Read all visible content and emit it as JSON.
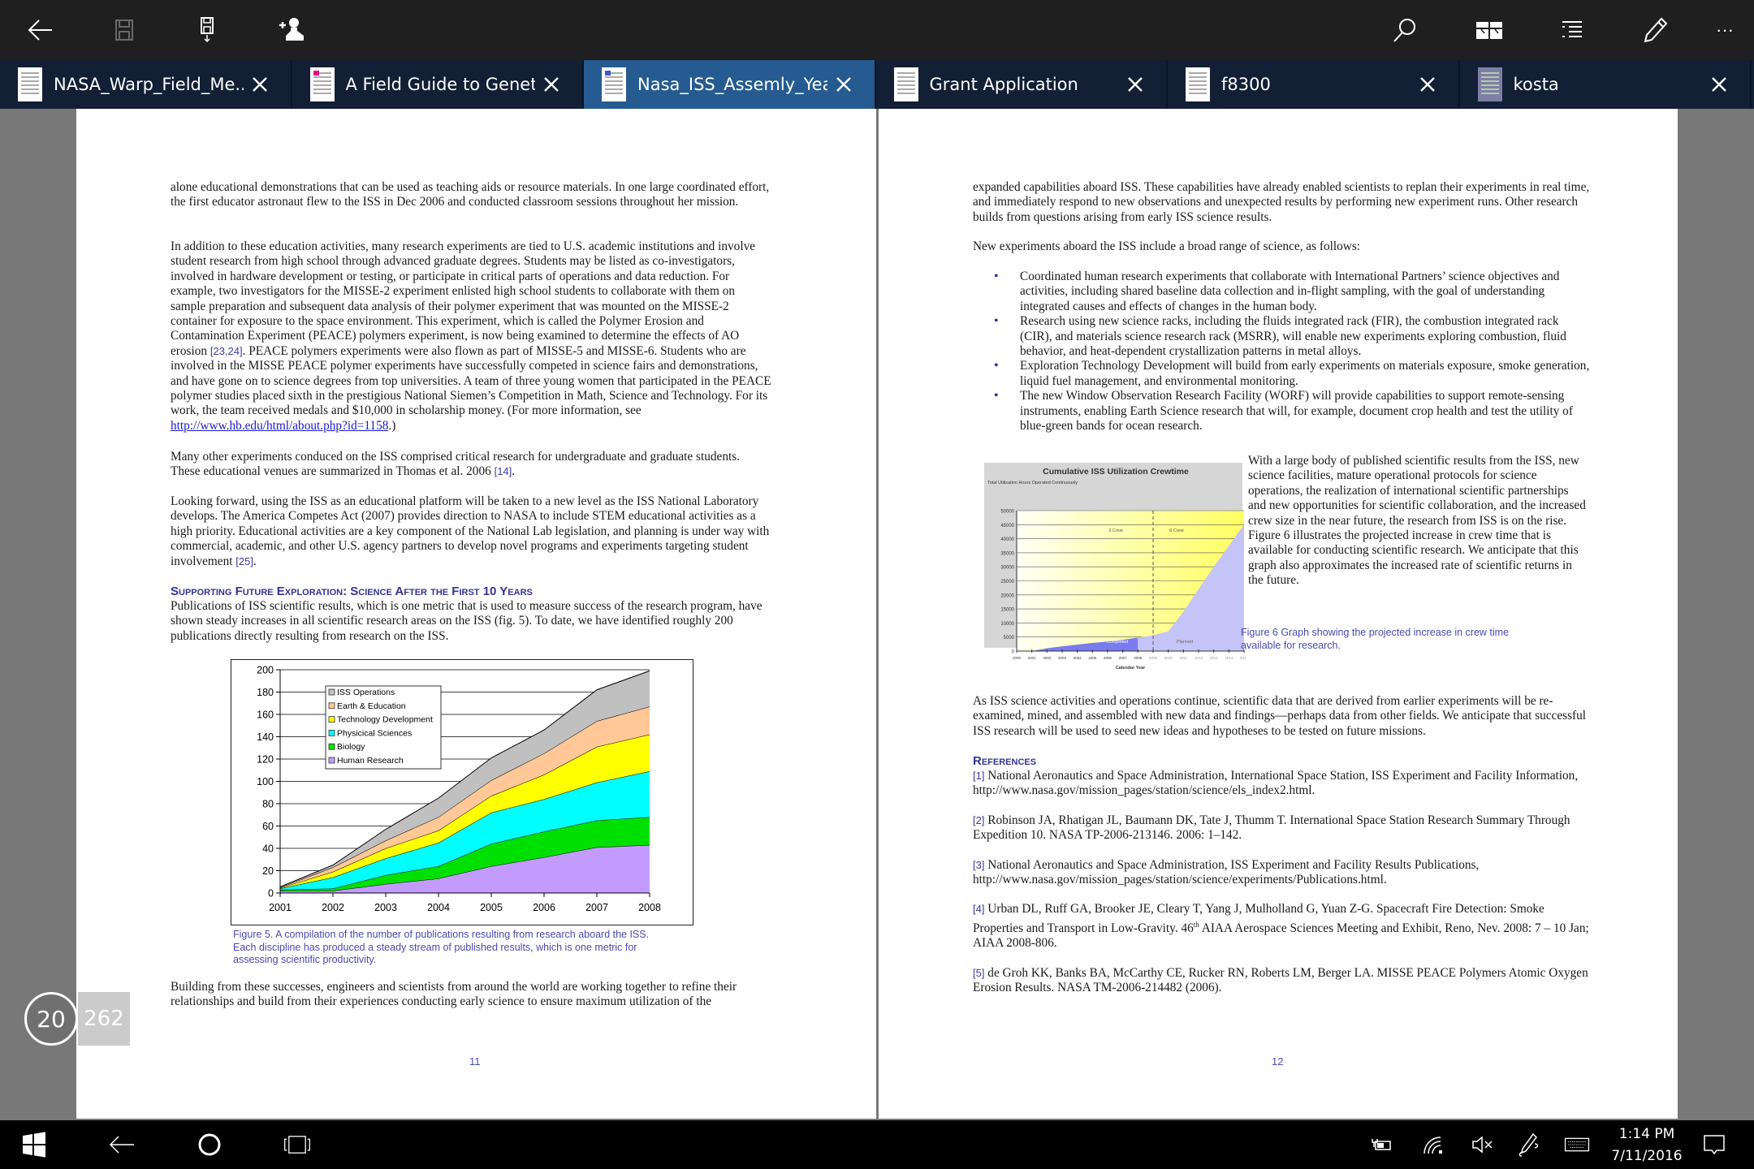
{
  "toolbar": {
    "left": [
      "back-icon",
      "save-icon",
      "save-as-icon",
      "share-user-icon"
    ],
    "right": [
      "search-icon",
      "two-page-view-icon",
      "outline-icon",
      "pen-icon",
      "more-icon"
    ],
    "more_label": "···"
  },
  "tabs": [
    {
      "label": "NASA_Warp_Field_Me...",
      "active": false
    },
    {
      "label": "A Field Guide to Genet...",
      "active": false
    },
    {
      "label": "Nasa_ISS_Assemly_Years",
      "active": true
    },
    {
      "label": "Grant Application",
      "active": false
    },
    {
      "label": "f8300",
      "active": false
    },
    {
      "label": "kosta",
      "active": false
    }
  ],
  "tab_close_label": "X",
  "left_page": {
    "p1": "alone educational demonstrations that can be used as teaching aids or resource materials. In one large coordinated effort, the first educator astronaut flew to the ISS in Dec 2006 and conducted classroom sessions throughout her mission.",
    "p2_a": "In addition to these education activities, many research experiments are tied to U.S. academic institutions and involve student research from high school through advanced graduate degrees. Students may be listed as co-investigators, involved in hardware development or testing, or participate in critical parts of operations and data reduction. For example, two investigators for the MISSE-2 experiment enlisted high school students to collaborate with them on sample preparation and subsequent data analysis of their polymer experiment that was mounted on the MISSE-2 container for exposure to the space environment. This experiment, which is called the Polymer Erosion and Contamination Experiment (PEACE) polymers experiment, is now being examined to determine the effects of AO erosion ",
    "p2_cite": "[23,24]",
    "p2_b": ". PEACE polymers experiments were also flown as part of MISSE-5 and MISSE-6. Students who are involved in the MISSE PEACE polymer experiments have successfully competed in science fairs and demonstrations, and have gone on to science degrees from top universities. A team of three young women that participated in the PEACE polymer studies placed sixth in the prestigious National Siemen’s Competition in Math, Science and Technology. For its work, the team received medals and $10,000 in scholarship money. (For more information, see ",
    "p2_link": "http://www.hb.edu/html/about.php?id=1158",
    "p2_c": ".)",
    "p3_a": "Many other experiments conduced on the ISS comprised critical research for undergraduate and graduate students. These educational venues are summarized in Thomas et al. 2006 ",
    "p3_cite": "[14]",
    "p3_b": ".",
    "p4_a": "Looking forward, using the ISS as an educational platform will be taken to a new level as the ISS National Laboratory develops. The America Competes Act (2007) provides direction to NASA to include STEM educational activities as a high priority. Educational activities are a key component of the National Lab legislation, and planning is under way with commercial, academic, and other U.S. agency partners to develop novel programs and experiments targeting student involvement ",
    "p4_cite": "[25]",
    "p4_b": ".",
    "heading": "Supporting Future Exploration: Science After the First 10 Years",
    "p5": "Publications of ISS scientific results, which is one metric that is used to measure success of the research program, have shown steady increases in all scientific research areas on the ISS (fig. 5). To date, we have identified roughly 200 publications directly resulting from research on the ISS.",
    "fig5_caption": "Figure 5. A compilation of the number of publications resulting from research aboard the ISS. Each discipline has produced a steady stream of published results, which is one metric for assessing scientific productivity.",
    "p6": "Building from these successes, engineers and scientists from around the world are working together to refine their relationships and build from their experiences conducting early science to ensure maximum utilization of the",
    "page_number": "11"
  },
  "right_page": {
    "p1": "expanded capabilities aboard ISS. These capabilities have already enabled scientists to replan their experiments in real time, and immediately respond to new observations and unexpected results by performing new experiment runs. Other research builds from questions arising from early ISS science results.",
    "p2": "New experiments aboard the ISS include a broad range of science, as follows:",
    "bullets": [
      "Coordinated human research experiments that collaborate with International Partners’ science objectives and activities, including shared baseline data collection and in-flight sampling, with the goal of understanding integrated causes and effects of changes in the human body.",
      "Research using new science racks, including the fluids integrated rack (FIR), the combustion integrated rack (CIR), and materials science research rack (MSRR), will enable new experiments exploring combustion, fluid behavior, and heat-dependent crystallization patterns in metal alloys.",
      "Exploration Technology Development will build from early experiments on materials exposure, smoke generation, liquid fuel management, and environmental monitoring.",
      "The new Window Observation Research Facility (WORF) will provide capabilities to support remote-sensing instruments, enabling Earth Science research that will, for example, document crop health and test the utility of blue-green bands for ocean research."
    ],
    "p3": "With a large body of published scientific results from the ISS, new science facilities, mature operational protocols for science operations, the realization of international scientific partnerships and new opportunities for scientific collaboration, and the increased crew size in the near future, the research from ISS is on the rise. Figure 6 illustrates the projected increase in crew time that is available for conducting scientific research. We anticipate that this graph also approximates the increased rate of scientific returns in the future.",
    "fig6_caption": "Figure 6 Graph showing the projected increase in crew time available for research.",
    "p4": "As ISS science activities and operations continue, scientific data that are derived from earlier experiments will be re-examined, mined, and assembled with new data and findings—perhaps data from other fields. We anticipate that successful ISS research will be used to seed new ideas and hypotheses to be tested on future missions.",
    "references_heading": "References",
    "references": [
      {
        "num": "[1]",
        "text": "National Aeronautics and Space Administration, International Space Station, ISS Experiment and Facility Information, http://www.nasa.gov/mission_pages/station/science/els_index2.html."
      },
      {
        "num": "[2]",
        "text": "Robinson JA, Rhatigan JL, Baumann DK, Tate J, Thumm T. International Space Station Research Summary Through Expedition 10. NASA TP-2006-213146. 2006: 1–142."
      },
      {
        "num": "[3]",
        "text": "National Aeronautics and Space Administration, ISS Experiment and Facility Results Publications, http://www.nasa.gov/mission_pages/station/science/experiments/Publications.html."
      },
      {
        "num": "[4]",
        "text_a": "Urban DL, Ruff GA, Brooker JE, Cleary T, Yang J, Mulholland G, Yuan Z-G. Spacecraft Fire Detection: Smoke Properties and Transport in Low-Gravity. 46",
        "sup": "th",
        "text_b": " AIAA Aerospace Sciences Meeting and Exhibit, Reno, Nev. 2008: 7 – 10 Jan; AIAA 2008-806."
      },
      {
        "num": "[5]",
        "text": "de Groh KK, Banks BA, McCarthy CE, Rucker RN, Roberts LM, Berger LA. MISSE PEACE Polymers Atomic Oxygen Erosion Results. NASA TM-2006-214482 (2006)."
      }
    ],
    "page_number": "12"
  },
  "chart_data": [
    {
      "type": "area",
      "stacked": true,
      "title": "",
      "xlabel": "",
      "ylabel": "",
      "categories": [
        "2001",
        "2002",
        "2003",
        "2004",
        "2005",
        "2006",
        "2007",
        "2008"
      ],
      "ylim": [
        0,
        200
      ],
      "yticks": [
        0,
        20,
        40,
        60,
        80,
        100,
        120,
        140,
        160,
        180,
        200
      ],
      "grid": true,
      "legend_position": "top-left",
      "series": [
        {
          "name": "Human Research",
          "color": "#c39bff",
          "values": [
            2,
            2,
            8,
            13,
            24,
            32,
            41,
            43
          ]
        },
        {
          "name": "Biology",
          "color": "#00e000",
          "values": [
            1,
            2,
            8,
            11,
            20,
            23,
            24,
            25
          ]
        },
        {
          "name": "Physicical Sciences",
          "color": "#00ffff",
          "values": [
            1,
            10,
            15,
            21,
            28,
            29,
            34,
            41
          ]
        },
        {
          "name": "Technology Development",
          "color": "#ffff00",
          "values": [
            0.5,
            5,
            9,
            11,
            15,
            22,
            32,
            33
          ]
        },
        {
          "name": "Earth & Education",
          "color": "#ffc896",
          "values": [
            0.5,
            4,
            7,
            12,
            14,
            19,
            23,
            25
          ]
        },
        {
          "name": "ISS Operations",
          "color": "#c0c0c0",
          "values": [
            0.5,
            2,
            10,
            17,
            20,
            21,
            28,
            32
          ]
        }
      ],
      "legend_order": [
        "ISS Operations",
        "Earth & Education",
        "Technology Development",
        "Physicical Sciences",
        "Biology",
        "Human Research"
      ]
    },
    {
      "type": "area",
      "title": "Cumulative ISS Utilization Crewtime",
      "xlabel": "Calendar Year",
      "ylabel": "Total Utilization Hours Operated Continuously",
      "categories": [
        "2000",
        "2001",
        "2002",
        "2003",
        "2004",
        "2005",
        "2006",
        "2007",
        "2008",
        "2009",
        "2010",
        "2011",
        "2012",
        "2013",
        "2014",
        "2015"
      ],
      "ylim": [
        0,
        50000
      ],
      "yticks": [
        0,
        5000,
        10000,
        15000,
        20000,
        25000,
        30000,
        35000,
        40000,
        45000,
        50000
      ],
      "ytick_labels": [
        "0",
        "5000",
        "10000",
        "15000",
        "20000",
        "25000",
        "30000",
        "35000",
        "40000",
        "45000",
        "50000"
      ],
      "series": [
        {
          "name": "Completed",
          "color": "#7b7bf0",
          "values": [
            0,
            0,
            1000,
            1700,
            2300,
            2900,
            3400,
            4000,
            4800,
            null,
            null,
            null,
            null,
            null,
            null,
            null
          ]
        },
        {
          "name": "Planned",
          "color": "#c4c4f8",
          "values": [
            null,
            null,
            null,
            null,
            null,
            null,
            null,
            null,
            4800,
            5600,
            7000,
            14000,
            22000,
            30000,
            37500,
            45000
          ]
        }
      ],
      "annotations": [
        "3 Crew",
        "6 Crew",
        "Completed",
        "Planned"
      ]
    }
  ],
  "page_counter": {
    "current": "20",
    "total": "262"
  },
  "taskbar": {
    "left": [
      "windows-start-icon",
      "back-icon",
      "cortana-icon",
      "task-view-icon"
    ],
    "tray": [
      "battery-charging-icon",
      "wifi-icon",
      "volume-muted-icon",
      "pen-workspace-icon",
      "touch-keyboard-icon",
      "action-center-icon"
    ],
    "time": "1:14 PM",
    "date": "7/11/2016"
  }
}
